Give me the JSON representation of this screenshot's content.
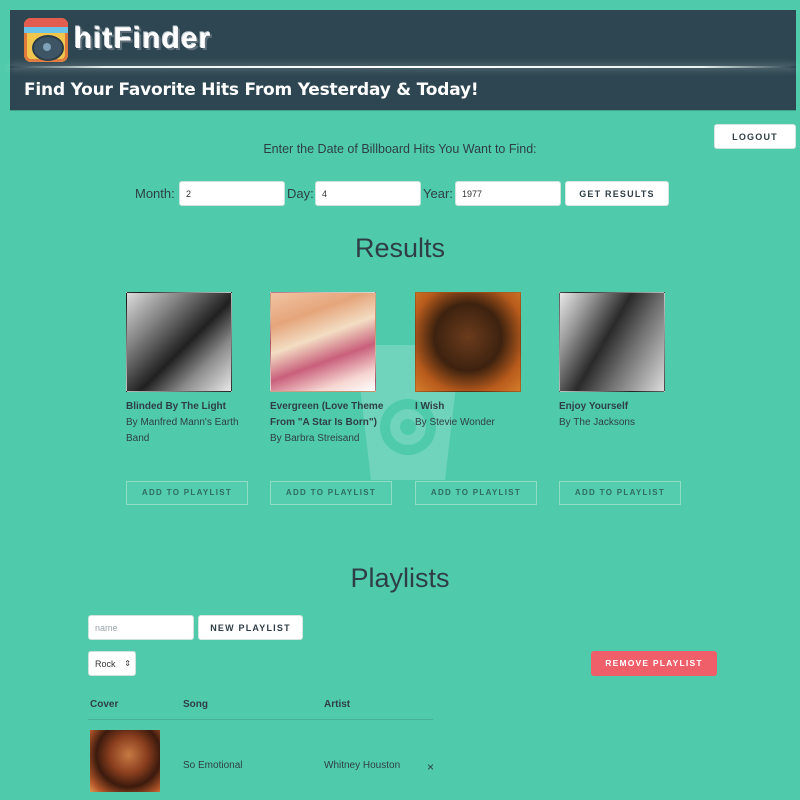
{
  "brand": {
    "logo_text": "hitFinder",
    "tagline": "Find Your Favorite Hits From Yesterday & Today!"
  },
  "header": {
    "logout_label": "LOGOUT"
  },
  "search": {
    "prompt": "Enter the Date of Billboard Hits You Want to Find:",
    "month_label": "Month:",
    "month_value": "2",
    "day_label": "Day:",
    "day_value": "4",
    "year_label": "Year:",
    "year_value": "1977",
    "submit_label": "GET RESULTS"
  },
  "results": {
    "title": "Results",
    "add_label": "ADD TO PLAYLIST",
    "items": [
      {
        "title": "Blinded By The Light",
        "artist": "By Manfred Mann's Earth Band"
      },
      {
        "title": "Evergreen (Love Theme From \"A Star Is Born\")",
        "artist": "By Barbra Streisand"
      },
      {
        "title": "I Wish",
        "artist": "By Stevie Wonder"
      },
      {
        "title": "Enjoy Yourself",
        "artist": "By The Jacksons"
      }
    ]
  },
  "playlists": {
    "title": "Playlists",
    "name_placeholder": "name",
    "new_label": "NEW PLAYLIST",
    "selected": "Rock",
    "remove_label": "REMOVE PLAYLIST",
    "columns": [
      "Cover",
      "Song",
      "Artist"
    ],
    "rows": [
      {
        "song": "So Emotional",
        "artist": "Whitney Houston",
        "remove": "×"
      }
    ]
  },
  "colors": {
    "background": "#4fcbac",
    "header": "#2d4651",
    "danger": "#ef5f6a"
  }
}
